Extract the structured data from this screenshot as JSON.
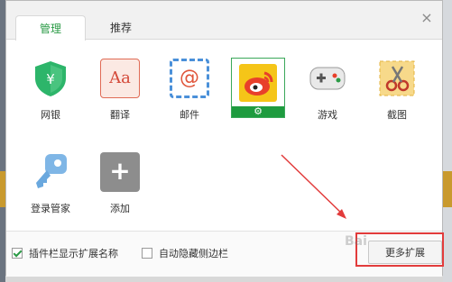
{
  "tabs": [
    {
      "label": "管理",
      "active": true
    },
    {
      "label": "推荐",
      "active": false
    }
  ],
  "close_label": "×",
  "apps": [
    {
      "label": "网银",
      "icon": "bank-shield-icon"
    },
    {
      "label": "翻译",
      "icon": "translate-icon",
      "glyph": "Aa"
    },
    {
      "label": "邮件",
      "icon": "mail-icon",
      "glyph": "@"
    },
    {
      "label": "",
      "icon": "weibo-icon",
      "selected": true,
      "bar_glyph": "⚙"
    },
    {
      "label": "游戏",
      "icon": "gamepad-icon"
    },
    {
      "label": "截图",
      "icon": "screenshot-icon"
    },
    {
      "label": "登录管家",
      "icon": "key-icon"
    },
    {
      "label": "添加",
      "icon": "add-icon",
      "glyph": "+"
    }
  ],
  "footer": {
    "show_names": {
      "label": "插件栏显示扩展名称",
      "checked": true
    },
    "auto_hide": {
      "label": "自动隐藏侧边栏",
      "checked": false
    },
    "more_button": "更多扩展"
  },
  "watermark": "Bai"
}
